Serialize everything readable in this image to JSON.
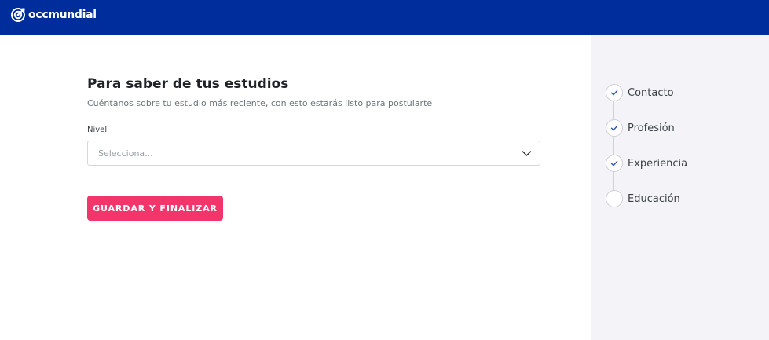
{
  "header": {
    "brand": "occmundial",
    "brand_color": "#002d9c"
  },
  "form": {
    "title": "Para saber de tus estudios",
    "subtitle": "Cuéntanos sobre tu estudio más reciente, con esto estarás listo para postularte",
    "level_label": "Nivel",
    "level_value": "Selecciona...",
    "submit_label": "GUARDAR Y FINALIZAR",
    "accent_color": "#f2366b"
  },
  "steps": [
    {
      "label": "Contacto",
      "done": true
    },
    {
      "label": "Profesión",
      "done": true
    },
    {
      "label": "Experiencia",
      "done": true
    },
    {
      "label": "Educación",
      "done": false
    }
  ],
  "icons": {
    "logo": "target-logo-icon",
    "select": "chevron-down-icon",
    "step_done": "check-icon"
  }
}
